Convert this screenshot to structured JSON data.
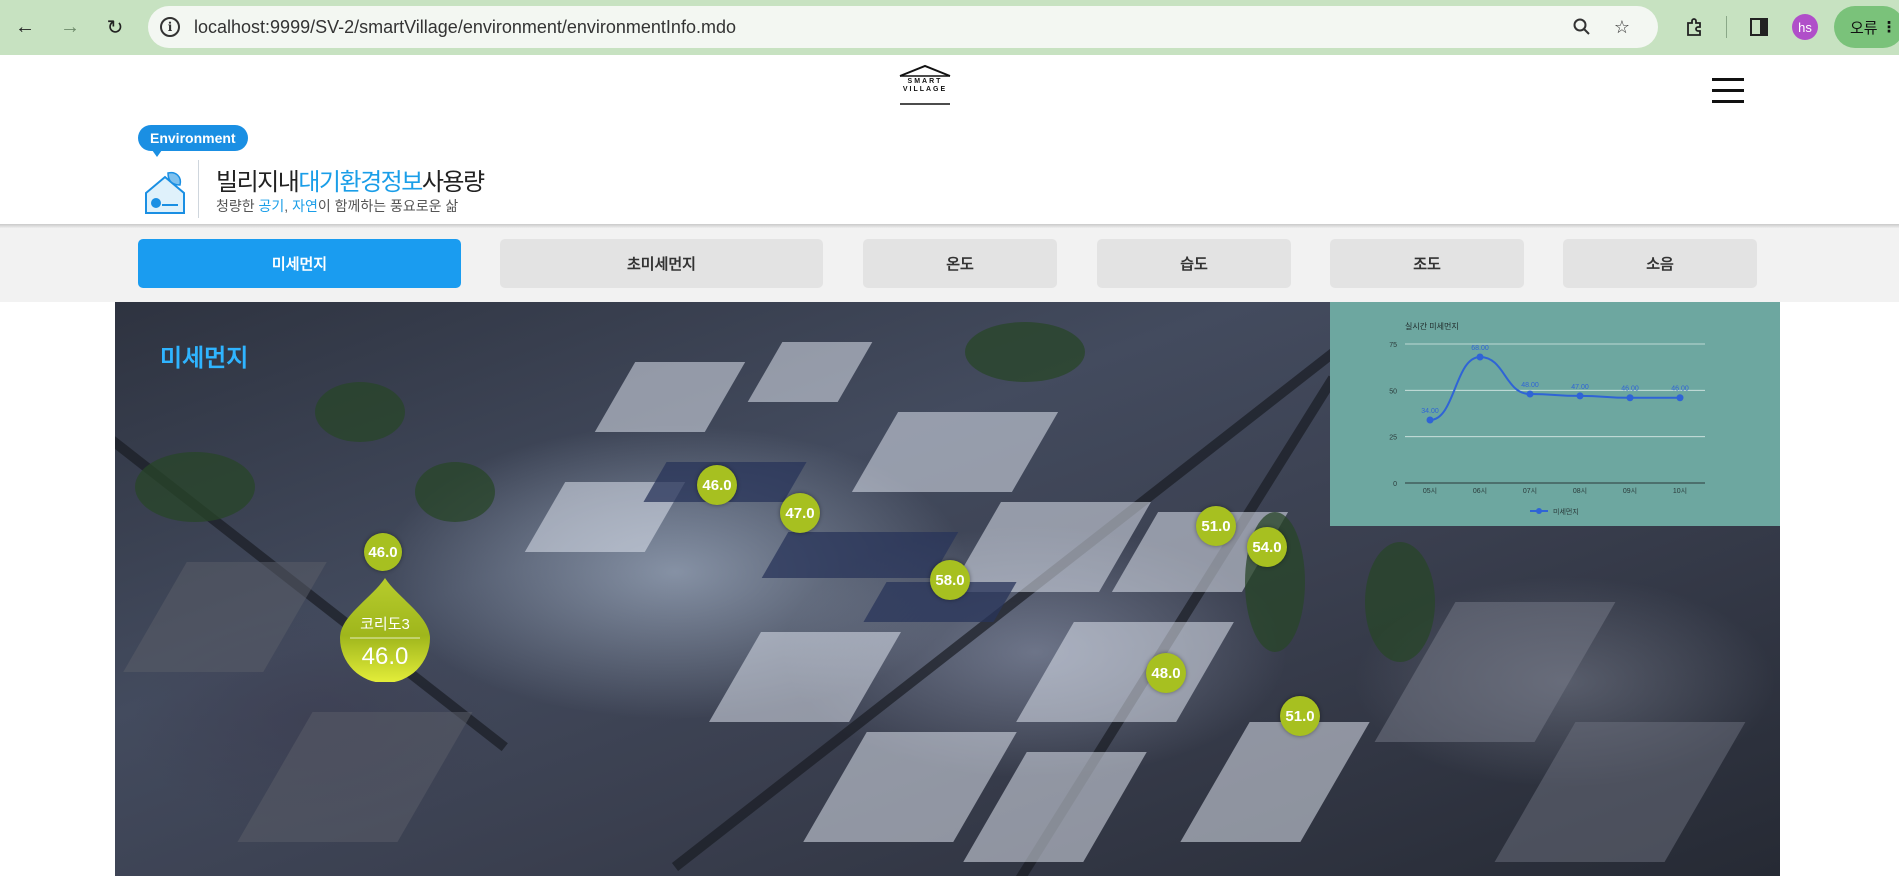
{
  "browser": {
    "url": "localhost:9999/SV-2/smartVillage/environment/environmentInfo.mdo",
    "profile_initials": "hs",
    "error_label": "오류"
  },
  "header": {
    "logo_text": "SMART VILLAGE",
    "badge": "Environment",
    "title_pre": "빌리지내",
    "title_hl": "대기환경정보",
    "title_post": "사용량",
    "subtitle_pre": "청량한 ",
    "subtitle_hl1": "공기",
    "subtitle_sep": ", ",
    "subtitle_hl2": "자연",
    "subtitle_post": "이 함께하는 풍요로운 삶"
  },
  "tabs": [
    {
      "label": "미세먼지",
      "active": true
    },
    {
      "label": "초미세먼지",
      "active": false
    },
    {
      "label": "온도",
      "active": false
    },
    {
      "label": "습도",
      "active": false
    },
    {
      "label": "조도",
      "active": false
    },
    {
      "label": "소음",
      "active": false
    }
  ],
  "map": {
    "title": "미세먼지",
    "markers": [
      "46.0",
      "46.0",
      "47.0",
      "58.0",
      "51.0",
      "54.0",
      "48.0",
      "51.0"
    ],
    "drop_label": "코리도3",
    "drop_value": "46.0",
    "marker_color": "#a7c020"
  },
  "chart_data": {
    "type": "line",
    "title": "실시간 미세먼지",
    "categories": [
      "05시",
      "06시",
      "07시",
      "08시",
      "09시",
      "10시"
    ],
    "series": [
      {
        "name": "미세먼지",
        "values": [
          34.0,
          68.0,
          48.0,
          47.0,
          46.0,
          46.0
        ]
      }
    ],
    "data_labels": [
      "34.00",
      "68.00",
      "48.00",
      "47.00",
      "46.00",
      "46.00"
    ],
    "yticks": [
      "0",
      "25",
      "50",
      "75"
    ],
    "ylim": [
      0,
      75
    ],
    "grid": true,
    "legend": "bottom",
    "line_color": "#2f64d6"
  }
}
